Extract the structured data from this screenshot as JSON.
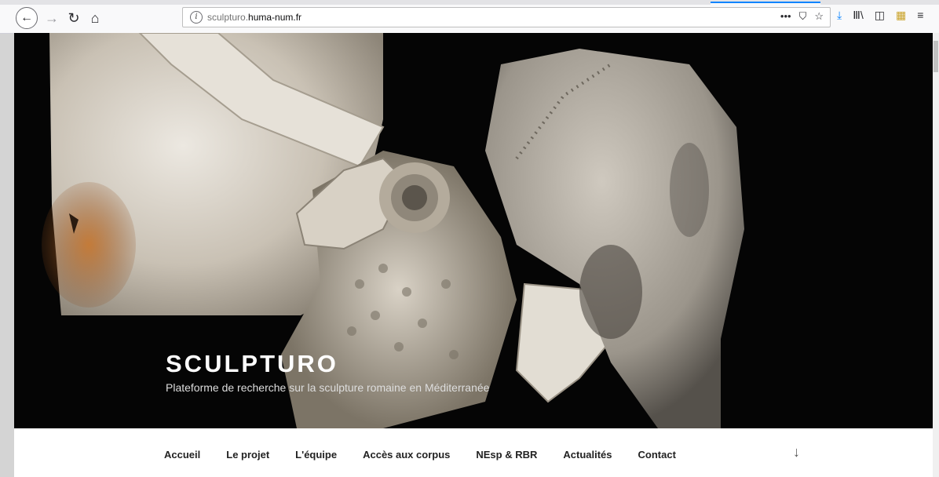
{
  "browser": {
    "url_prefix": "sculpturo.",
    "url_domain": "huma-num.fr",
    "actions": [
      "•••",
      "⛉",
      "☆"
    ],
    "toolbar": [
      "⤓",
      "Ⅲ\\",
      "◫",
      "▦",
      "≡"
    ]
  },
  "site": {
    "title": "SCULPTURO",
    "description": "Plateforme de recherche sur la sculpture romaine en Méditerranée"
  },
  "nav": {
    "items": [
      "Accueil",
      "Le projet",
      "L'équipe",
      "Accès aux corpus",
      "NEsp & RBR",
      "Actualités",
      "Contact"
    ],
    "scroll_down": "↓"
  },
  "colors": {
    "accent": "#0a84ff",
    "marble": "#cfc8bc",
    "rust": "#b8672a"
  }
}
